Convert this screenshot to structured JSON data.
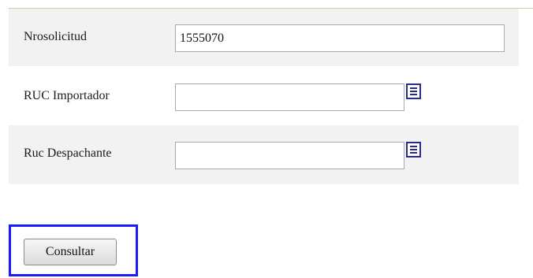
{
  "form": {
    "fields": [
      {
        "label": "Nrosolicitud",
        "value": "1555070"
      },
      {
        "label": "RUC Importador",
        "value": ""
      },
      {
        "label": "Ruc Despachante",
        "value": ""
      }
    ],
    "submit_label": "Consultar"
  },
  "icons": {
    "lookup": "list-lookup-icon"
  },
  "colors": {
    "row_shade": "#f2f2f2",
    "highlight_border": "#1a1aff",
    "top_rule": "#c8d3a8",
    "icon_accent": "#2a2a8c"
  }
}
